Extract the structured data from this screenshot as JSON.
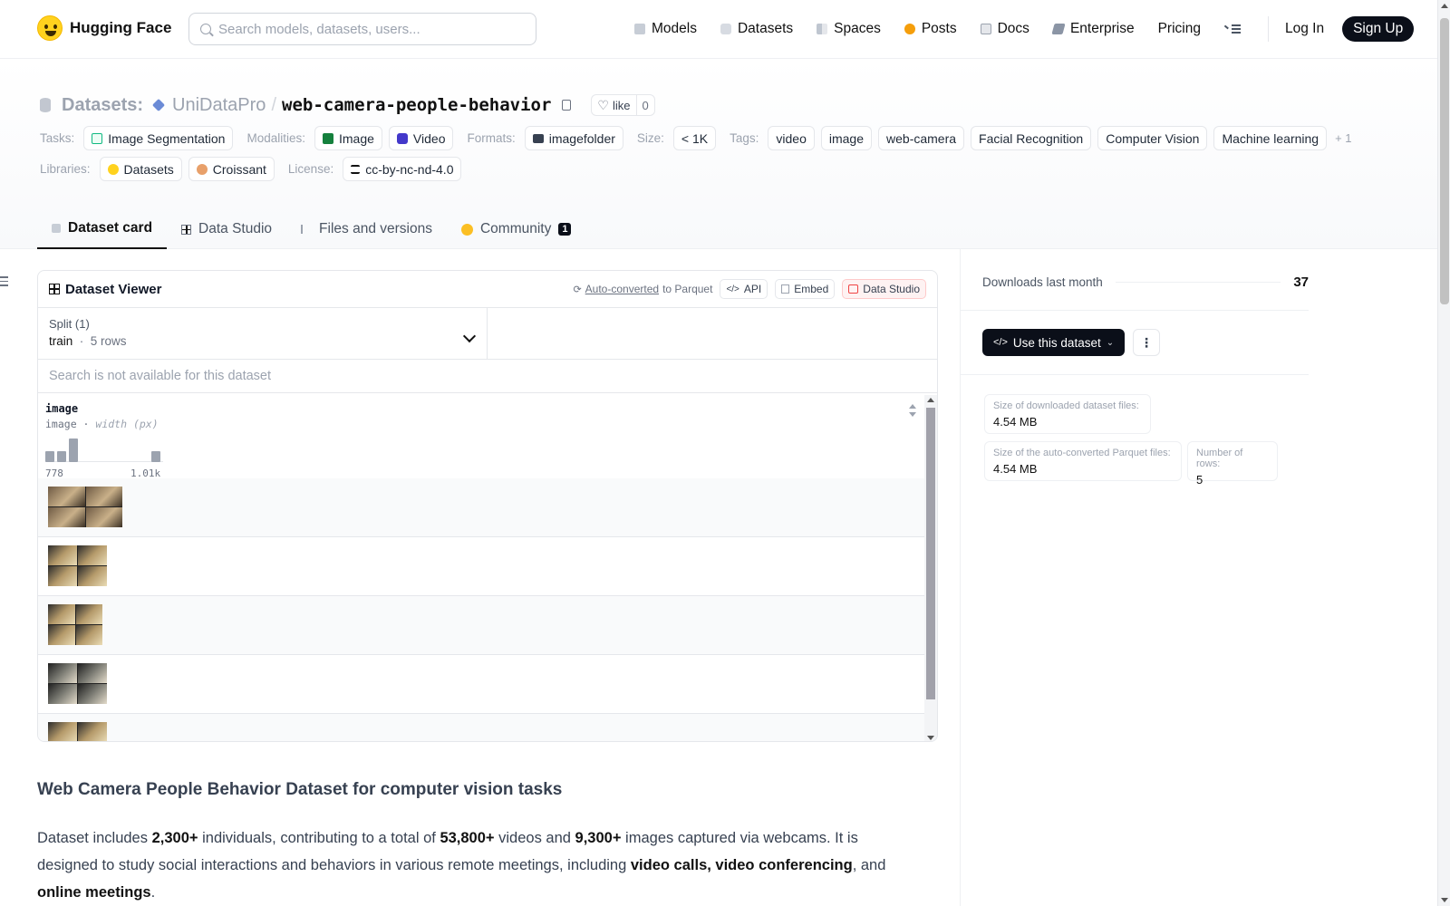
{
  "nav": {
    "brand": "Hugging Face",
    "search_placeholder": "Search models, datasets, users...",
    "items": [
      {
        "label": "Models",
        "icon": "cube-icon"
      },
      {
        "label": "Datasets",
        "icon": "database-icon"
      },
      {
        "label": "Spaces",
        "icon": "spaces-icon"
      },
      {
        "label": "Posts",
        "icon": "posts-icon"
      },
      {
        "label": "Docs",
        "icon": "docs-icon"
      },
      {
        "label": "Enterprise",
        "icon": "enterprise-icon"
      },
      {
        "label": "Pricing"
      }
    ],
    "login": "Log In",
    "signup": "Sign Up"
  },
  "header": {
    "crumb_label": "Datasets:",
    "org": "UniDataPro",
    "sep": "/",
    "name": "web-camera-people-behavior",
    "like_label": "like",
    "like_count": "0",
    "tasks_label": "Tasks:",
    "tasks": [
      "Image Segmentation"
    ],
    "modalities_label": "Modalities:",
    "modalities": [
      "Image",
      "Video"
    ],
    "formats_label": "Formats:",
    "formats": [
      "imagefolder"
    ],
    "size_label": "Size:",
    "size": "< 1K",
    "tags_label": "Tags:",
    "tags": [
      "video",
      "image",
      "web-camera",
      "Facial Recognition",
      "Computer Vision",
      "Machine learning"
    ],
    "tags_more": "+ 1",
    "libraries_label": "Libraries:",
    "libraries": [
      "Datasets",
      "Croissant"
    ],
    "license_label": "License:",
    "license": "cc-by-nc-nd-4.0"
  },
  "tabs": [
    {
      "label": "Dataset card",
      "active": true
    },
    {
      "label": "Data Studio"
    },
    {
      "label": "Files and versions"
    },
    {
      "label": "Community",
      "badge": "1"
    }
  ],
  "viewer": {
    "title": "Dataset Viewer",
    "auto_converted": "Auto-converted",
    "to_parquet": "to Parquet",
    "api": "API",
    "embed": "Embed",
    "data_studio": "Data Studio",
    "split_label": "Split (1)",
    "split_value": "train",
    "split_rows": "5 rows",
    "search_msg": "Search is not available for this dataset",
    "column": {
      "name": "image",
      "type": "image",
      "subtype": "width (px)",
      "hist_min": "778",
      "hist_max": "1.01k",
      "hist_values": [
        0.45,
        0.45,
        1.0,
        0.0,
        0.0,
        0.0,
        0.0,
        0.0,
        0.0,
        0.45
      ]
    },
    "rows": 5
  },
  "sidebar": {
    "downloads_label": "Downloads last month",
    "downloads": "37",
    "use_btn": "Use this dataset",
    "stats": [
      {
        "k": "Size of downloaded dataset files:",
        "v": "4.54 MB"
      },
      {
        "k": "Size of the auto-converted Parquet files:",
        "v": "4.54 MB"
      },
      {
        "k": "Number of rows:",
        "v": "5"
      }
    ]
  },
  "card": {
    "title": "Web Camera People Behavior Dataset for computer vision tasks",
    "p1_a": "Dataset includes ",
    "p1_b": "2,300+",
    "p1_c": " individuals, contributing to a total of ",
    "p1_d": "53,800+",
    "p1_e": " videos and ",
    "p1_f": "9,300+",
    "p1_g": " images captured via webcams. It is designed to study social interactions and behaviors in various remote meetings, including ",
    "p1_h": "video calls, video conferencing",
    "p1_i": ", and ",
    "p1_j": "online meetings",
    "p1_k": "."
  }
}
